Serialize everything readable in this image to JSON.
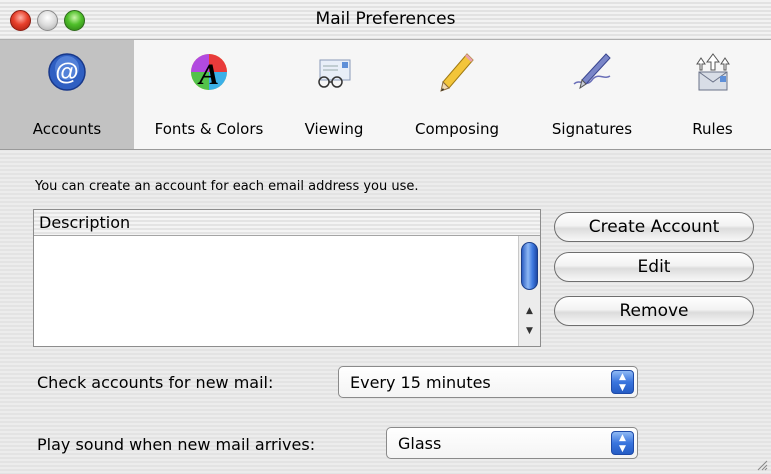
{
  "window": {
    "title": "Mail Preferences",
    "controls": [
      "close-button",
      "minimize-button",
      "zoom-button"
    ]
  },
  "toolbar": {
    "selected": "Accounts",
    "items": [
      {
        "label": "Accounts",
        "icon": "at-sign-icon"
      },
      {
        "label": "Fonts & Colors",
        "icon": "font-color-icon"
      },
      {
        "label": "Viewing",
        "icon": "glasses-envelope-icon"
      },
      {
        "label": "Composing",
        "icon": "pencil-icon"
      },
      {
        "label": "Signatures",
        "icon": "pen-signature-icon"
      },
      {
        "label": "Rules",
        "icon": "rules-arrows-icon"
      }
    ]
  },
  "accounts": {
    "hint": "You can create an account for each email address you use.",
    "list_header": "Description",
    "rows": [],
    "buttons": {
      "create": "Create Account",
      "edit": "Edit",
      "remove": "Remove"
    }
  },
  "check_mail": {
    "label": "Check accounts for new mail:",
    "value": "Every 15 minutes"
  },
  "sound": {
    "label": "Play sound when new mail arrives:",
    "value": "Glass"
  },
  "colors": {
    "selected_tab": "#c2c2c2",
    "popup_accent": "#3a75de",
    "scroll_thumb": "#3f7ae0"
  }
}
